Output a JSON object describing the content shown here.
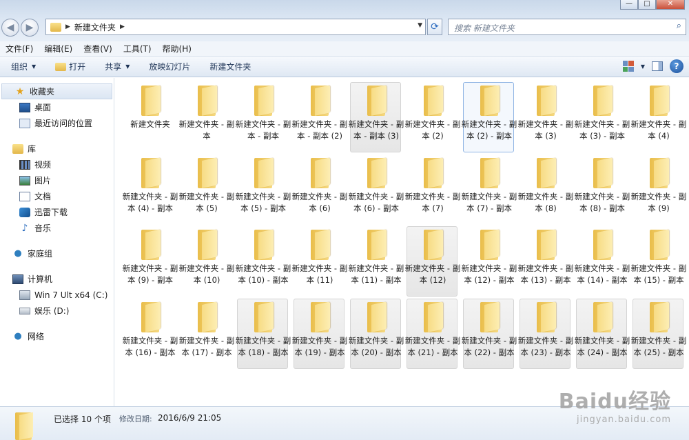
{
  "window": {
    "buttons": [
      "—",
      "□",
      "✕"
    ]
  },
  "address": {
    "path": "新建文件夹",
    "search_placeholder": "搜索 新建文件夹"
  },
  "menubar": {
    "items": [
      "文件(F)",
      "编辑(E)",
      "查看(V)",
      "工具(T)",
      "帮助(H)"
    ]
  },
  "toolbar": {
    "organize": "组织",
    "open": "打开",
    "share": "共享",
    "slideshow": "放映幻灯片",
    "new_folder": "新建文件夹"
  },
  "sidebar": {
    "favorites": "收藏夹",
    "desktop": "桌面",
    "recent": "最近访问的位置",
    "libraries": "库",
    "videos": "视频",
    "pictures": "图片",
    "documents": "文档",
    "thunder": "迅雷下载",
    "music": "音乐",
    "homegroup": "家庭组",
    "computer": "计算机",
    "drive_c": "Win 7 Ult x64 (C:)",
    "drive_d": "娱乐 (D:)",
    "network": "网络"
  },
  "folders": [
    "新建文件夹",
    "新建文件夹 - 副本",
    "新建文件夹 - 副本 - 副本",
    "新建文件夹 - 副本 - 副本 (2)",
    "新建文件夹 - 副本 - 副本 (3)",
    "新建文件夹 - 副本 (2)",
    "新建文件夹 - 副本 (2) - 副本",
    "新建文件夹 - 副本 (3)",
    "新建文件夹 - 副本 (3) - 副本",
    "新建文件夹 - 副本 (4)",
    "新建文件夹 - 副本 (4) - 副本",
    "新建文件夹 - 副本 (5)",
    "新建文件夹 - 副本 (5) - 副本",
    "新建文件夹 - 副本 (6)",
    "新建文件夹 - 副本 (6) - 副本",
    "新建文件夹 - 副本 (7)",
    "新建文件夹 - 副本 (7) - 副本",
    "新建文件夹 - 副本 (8)",
    "新建文件夹 - 副本 (8) - 副本",
    "新建文件夹 - 副本 (9)",
    "新建文件夹 - 副本 (9) - 副本",
    "新建文件夹 - 副本 (10)",
    "新建文件夹 - 副本 (10) - 副本",
    "新建文件夹 - 副本 (11)",
    "新建文件夹 - 副本 (11) - 副本",
    "新建文件夹 - 副本 (12)",
    "新建文件夹 - 副本 (12) - 副本",
    "新建文件夹 - 副本 (13) - 副本",
    "新建文件夹 - 副本 (14) - 副本",
    "新建文件夹 - 副本 (15) - 副本",
    "新建文件夹 - 副本 (16) - 副本",
    "新建文件夹 - 副本 (17) - 副本",
    "新建文件夹 - 副本 (18) - 副本",
    "新建文件夹 - 副本 (19) - 副本",
    "新建文件夹 - 副本 (20) - 副本",
    "新建文件夹 - 副本 (21) - 副本",
    "新建文件夹 - 副本 (22) - 副本",
    "新建文件夹 - 副本 (23) - 副本",
    "新建文件夹 - 副本 (24) - 副本",
    "新建文件夹 - 副本 (25) - 副本"
  ],
  "selected_indices": [
    4,
    25,
    32,
    33,
    34,
    35,
    36,
    37,
    38,
    39
  ],
  "focused_index": 6,
  "details": {
    "selected": "已选择 10 个项",
    "date_label": "修改日期:",
    "date_value": "2016/6/9 21:05"
  },
  "watermark": {
    "line1": "Baidu经验",
    "line2": "jingyan.baidu.com"
  }
}
